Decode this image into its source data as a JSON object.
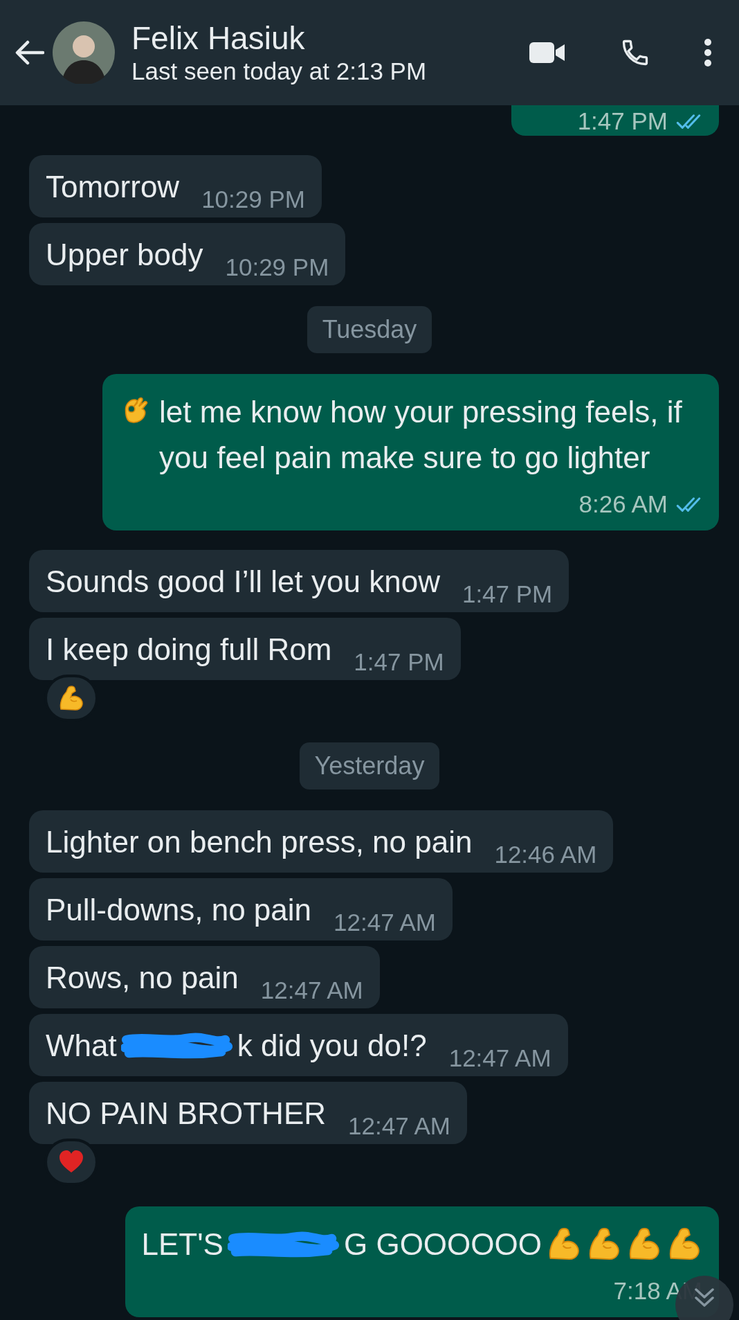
{
  "header": {
    "title": "Felix Hasiuk",
    "status": "Last seen today at 2:13 PM"
  },
  "messages": [
    {
      "kind": "message",
      "sent": true,
      "time": "1:47 PM",
      "read": true
    },
    {
      "kind": "message",
      "sent": false,
      "parts": [
        {
          "kind": "text",
          "text": "Tomorrow"
        }
      ],
      "time": "10:29 PM"
    },
    {
      "kind": "message",
      "sent": false,
      "parts": [
        {
          "kind": "text",
          "text": "Upper body"
        }
      ],
      "time": "10:29 PM"
    },
    {
      "kind": "date",
      "text": "Tuesday"
    },
    {
      "kind": "message",
      "sent": true,
      "parts": [
        {
          "kind": "okhand"
        },
        {
          "kind": "text",
          "text": "let me know how your pressing feels, if you feel pain make sure to go lighter"
        }
      ],
      "time": "8:26 AM",
      "read": true
    },
    {
      "kind": "message",
      "sent": false,
      "parts": [
        {
          "kind": "text",
          "text": "Sounds good I’ll let you know"
        }
      ],
      "time": "1:47 PM"
    },
    {
      "kind": "message",
      "sent": false,
      "parts": [
        {
          "kind": "text",
          "text": "I keep doing full Rom"
        }
      ],
      "time": "1:47 PM",
      "reaction": {
        "kind": "biceps"
      }
    },
    {
      "kind": "date",
      "text": "Yesterday"
    },
    {
      "kind": "message",
      "sent": false,
      "parts": [
        {
          "kind": "text",
          "text": "Lighter on bench press, no pain"
        }
      ],
      "time": "12:46 AM"
    },
    {
      "kind": "message",
      "sent": false,
      "parts": [
        {
          "kind": "text",
          "text": "Pull-downs, no pain"
        }
      ],
      "time": "12:47 AM"
    },
    {
      "kind": "message",
      "sent": false,
      "parts": [
        {
          "kind": "text",
          "text": "Rows, no pain"
        }
      ],
      "time": "12:47 AM"
    },
    {
      "kind": "message",
      "sent": false,
      "parts": [
        {
          "kind": "text",
          "text": "What"
        },
        {
          "kind": "redaction"
        },
        {
          "kind": "text",
          "text": "k did you do!?"
        }
      ],
      "time": "12:47 AM"
    },
    {
      "kind": "message",
      "sent": false,
      "parts": [
        {
          "kind": "text",
          "text": "NO PAIN BROTHER"
        }
      ],
      "time": "12:47 AM",
      "reaction": {
        "kind": "heart"
      }
    },
    {
      "kind": "message",
      "sent": true,
      "parts": [
        {
          "kind": "text",
          "text": "LET'S"
        },
        {
          "kind": "redaction"
        },
        {
          "kind": "text",
          "text": "G GOOOOOO"
        },
        {
          "kind": "biceps"
        },
        {
          "kind": "biceps"
        },
        {
          "kind": "biceps"
        },
        {
          "kind": "biceps"
        }
      ],
      "time": "7:18 AM"
    }
  ]
}
